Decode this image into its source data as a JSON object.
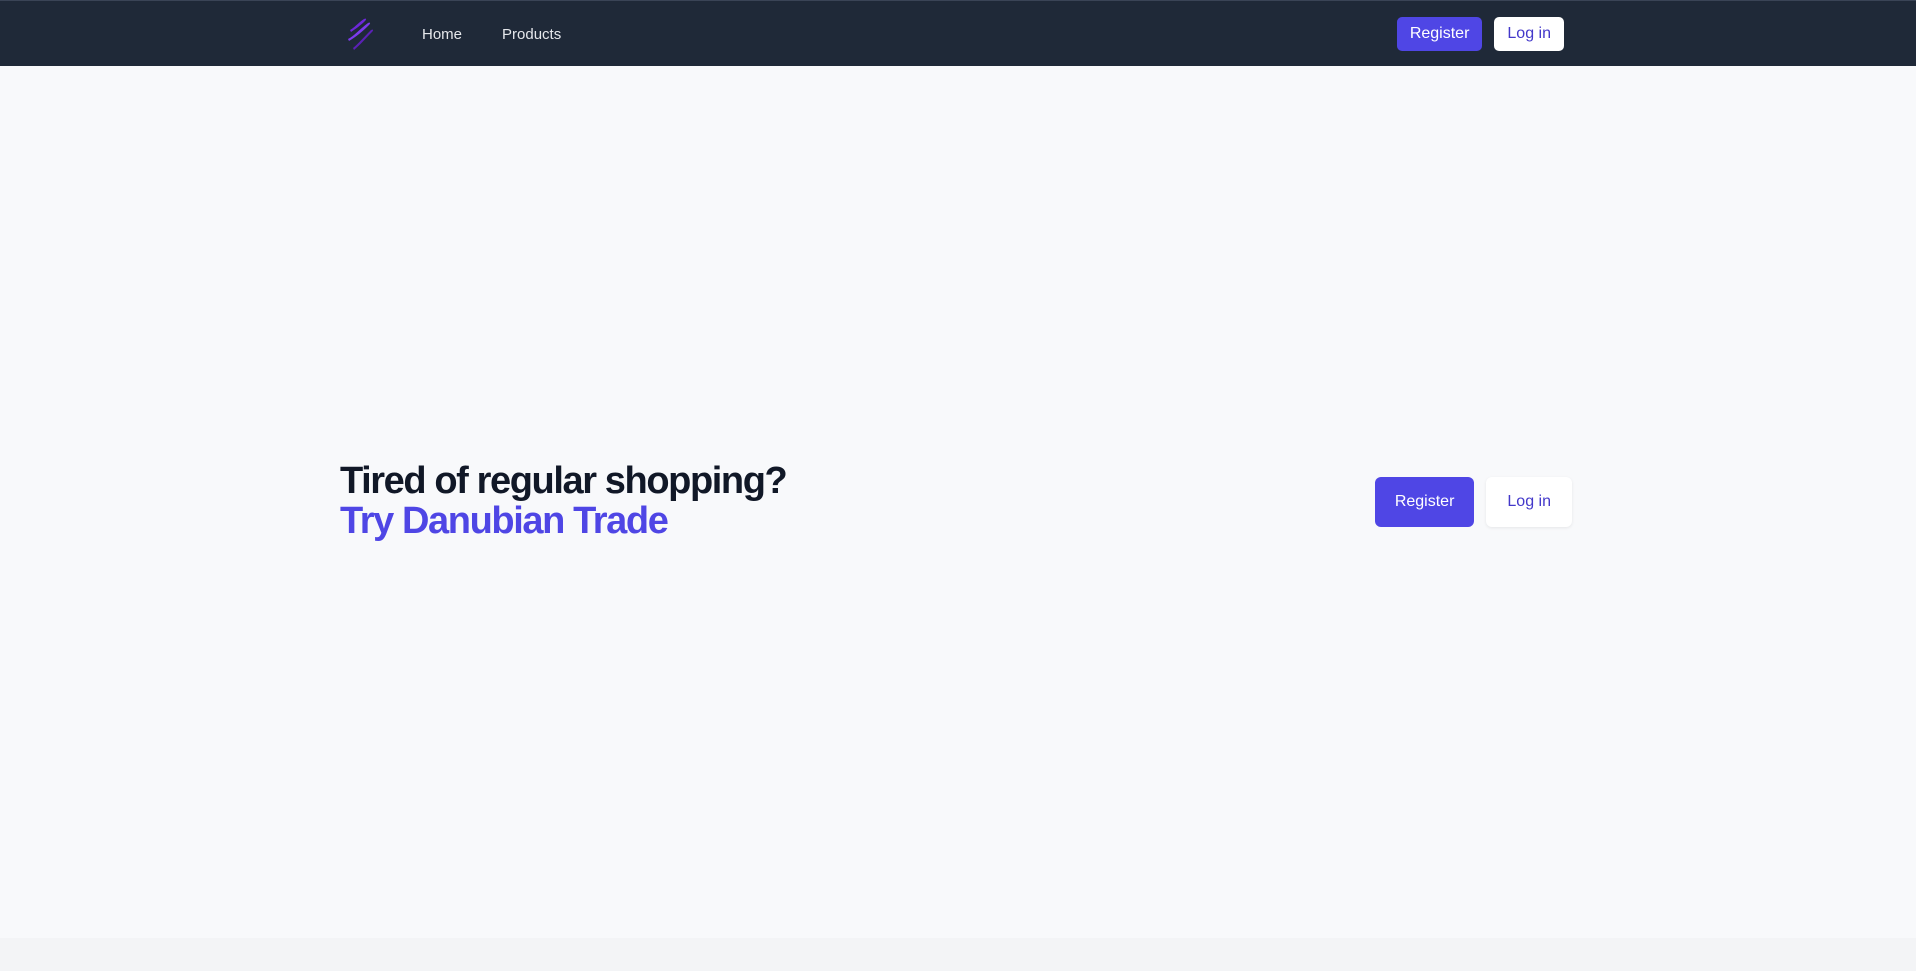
{
  "navbar": {
    "logo_icon": "danubian-wave-logo",
    "links": [
      {
        "label": "Home"
      },
      {
        "label": "Products"
      }
    ],
    "register_label": "Register",
    "login_label": "Log in"
  },
  "hero": {
    "title_line1": "Tired of regular shopping?",
    "title_line2": "Try Danubian Trade",
    "register_label": "Register",
    "login_label": "Log in"
  },
  "colors": {
    "navbar_bg": "#1f2938",
    "accent": "#4f46e5",
    "page_bg": "#f8f9fb",
    "heading": "#111827"
  }
}
